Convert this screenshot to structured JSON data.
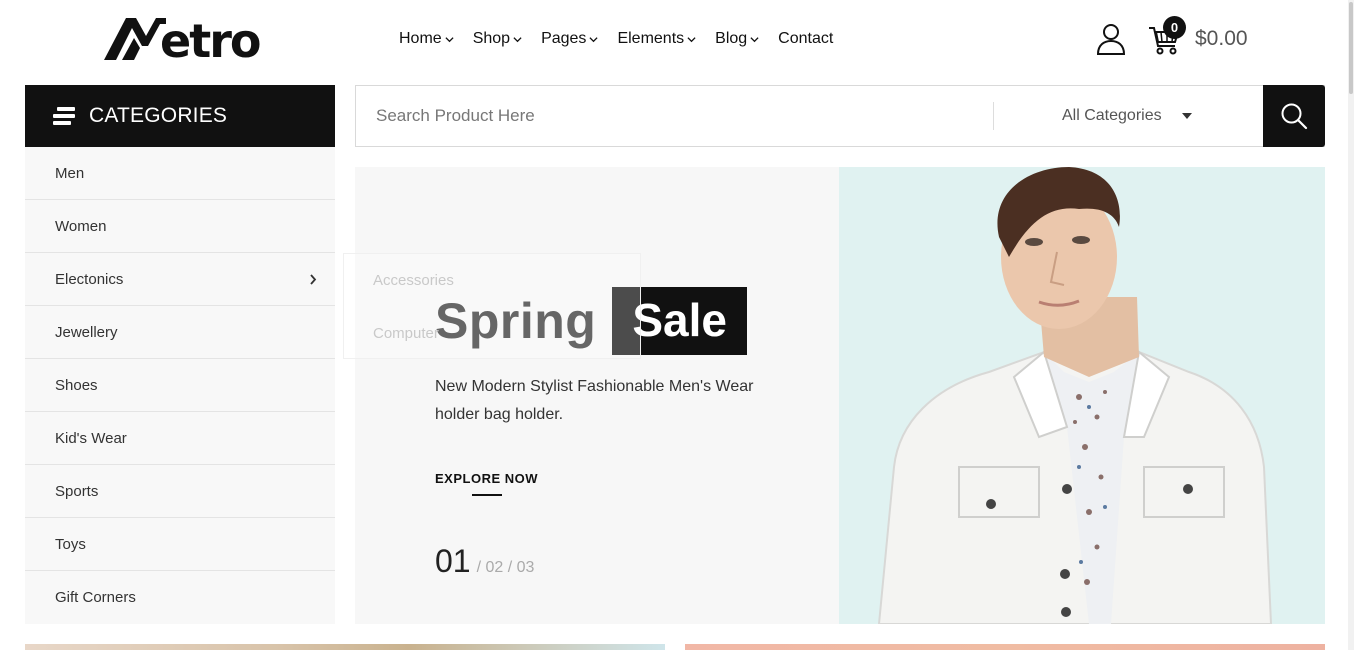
{
  "brand": {
    "name": "etro"
  },
  "nav": {
    "items": [
      {
        "label": "Home",
        "has_dropdown": true
      },
      {
        "label": "Shop",
        "has_dropdown": true
      },
      {
        "label": "Pages",
        "has_dropdown": true
      },
      {
        "label": "Elements",
        "has_dropdown": true
      },
      {
        "label": "Blog",
        "has_dropdown": true
      },
      {
        "label": "Contact",
        "has_dropdown": false
      }
    ]
  },
  "header": {
    "cart_count": "0",
    "cart_total": "$0.00",
    "icons": [
      "user-icon",
      "cart-icon"
    ]
  },
  "categories": {
    "title": "CATEGORIES",
    "items": [
      {
        "label": "Men"
      },
      {
        "label": "Women"
      },
      {
        "label": "Electonics",
        "has_submenu": true
      },
      {
        "label": "Jewellery"
      },
      {
        "label": "Shoes"
      },
      {
        "label": "Kid's Wear"
      },
      {
        "label": "Sports"
      },
      {
        "label": "Toys"
      },
      {
        "label": "Gift Corners"
      }
    ],
    "submenu": [
      "Accessories",
      "Computer"
    ]
  },
  "search": {
    "placeholder": "Search Product Here",
    "value": "",
    "category_selected": "All Categories"
  },
  "hero": {
    "title_word1": "Spring",
    "title_word2": "Sale",
    "description": "New Modern Stylist Fashionable Men's Wear holder bag holder.",
    "cta": "EXPLORE NOW",
    "pager_current": "01",
    "pager_rest": "/ 02 / 03"
  },
  "colors": {
    "primary": "#111111",
    "hero_bg": "#f7f7f7",
    "hero_photo_bg": "#e0f2f1",
    "sidebar_bg": "#f8f8f8"
  }
}
